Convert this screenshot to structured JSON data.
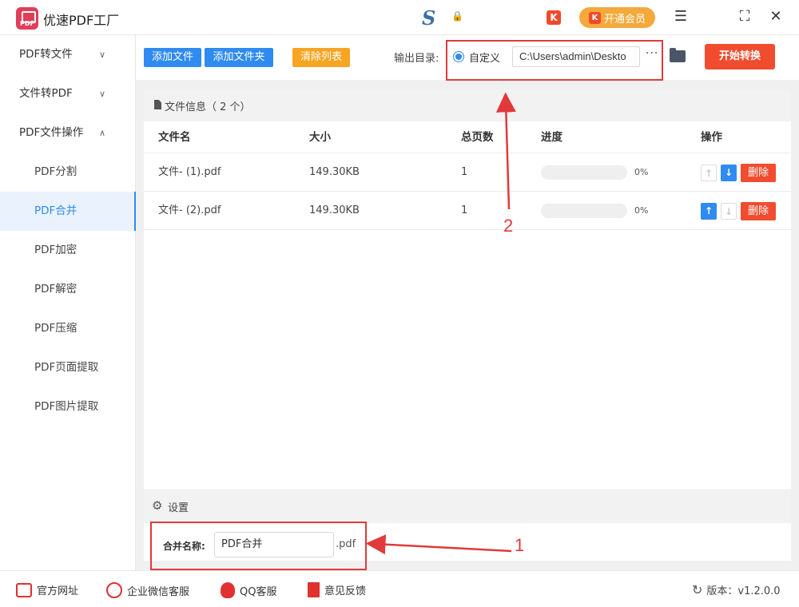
{
  "app": {
    "title": "优速PDF工厂",
    "logo_text": "PDF"
  },
  "titlebar": {
    "center_glyph": "S",
    "lock_glyph": "🔒",
    "vip_icon": "K",
    "vip_label": "开通会员",
    "k_icon": "K"
  },
  "sidebar": {
    "groups": [
      {
        "label": "PDF转文件",
        "chevron": "⌄"
      },
      {
        "label": "文件转PDF",
        "chevron": "⌄"
      },
      {
        "label": "PDF文件操作",
        "chevron": "⌃"
      }
    ],
    "sub_items": [
      "PDF分割",
      "PDF合并",
      "PDF加密",
      "PDF解密",
      "PDF压缩",
      "PDF页面提取",
      "PDF图片提取"
    ],
    "active": "PDF合并"
  },
  "toolbar": {
    "add_file": "添加文件",
    "add_folder": "添加文件夹",
    "clear_list": "清除列表",
    "output_label": "输出目录:",
    "radio_label": "自定义",
    "path_value": "C:\\Users\\admin\\Deskto",
    "more": "···",
    "start": "开始转换"
  },
  "file_panel": {
    "header": "文件信息（ 2 个）",
    "columns": [
      "文件名",
      "大小",
      "总页数",
      "进度",
      "操作"
    ],
    "rows": [
      {
        "name": "文件- (1).pdf",
        "size": "149.30KB",
        "pages": "1",
        "progress": "0%",
        "up_enabled": false,
        "down_enabled": true,
        "delete": "删除"
      },
      {
        "name": "文件- (2).pdf",
        "size": "149.30KB",
        "pages": "1",
        "progress": "0%",
        "up_enabled": true,
        "down_enabled": false,
        "delete": "删除"
      }
    ]
  },
  "settings": {
    "header": "设置",
    "merge_label": "合并名称:",
    "merge_value": "PDF合并",
    "ext": ".pdf"
  },
  "annotations": {
    "label_1": "1",
    "label_2": "2",
    "color": "#e03a3a"
  },
  "footer": {
    "website": "官方网址",
    "wechat": "企业微信客服",
    "qq": "QQ客服",
    "feedback": "意见反馈",
    "version": "版本：v1.2.0.0"
  },
  "colors": {
    "accent": "#2f8bf0",
    "danger": "#f14c2f",
    "warning": "#f7a523",
    "vip": "#f4a93b"
  }
}
